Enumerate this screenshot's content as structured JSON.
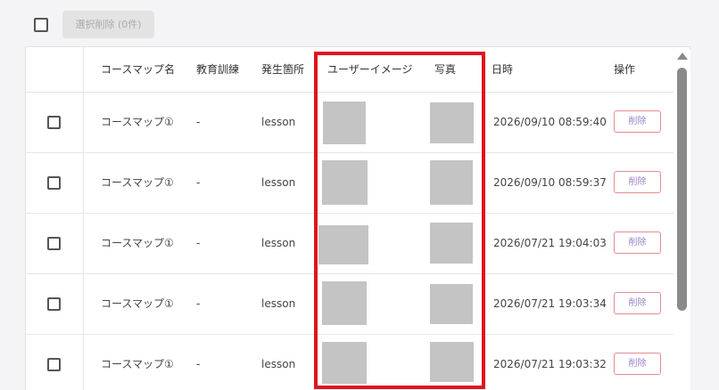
{
  "toolbar": {
    "bulk_delete_label": "選択削除 (0件)"
  },
  "table": {
    "headers": {
      "course_map_name": "コースマップ名",
      "training": "教育訓練",
      "location": "発生箇所",
      "user_image": "ユーザーイメージ",
      "photo": "写真",
      "datetime": "日時",
      "actions": "操作"
    },
    "rows": [
      {
        "course_map_name": "コースマップ①",
        "training": "-",
        "location": "lesson",
        "datetime": "2026/09/10 08:59:40",
        "delete_label": "削除"
      },
      {
        "course_map_name": "コースマップ①",
        "training": "-",
        "location": "lesson",
        "datetime": "2026/09/10 08:59:37",
        "delete_label": "削除"
      },
      {
        "course_map_name": "コースマップ①",
        "training": "-",
        "location": "lesson",
        "datetime": "2026/07/21 19:04:03",
        "delete_label": "削除"
      },
      {
        "course_map_name": "コースマップ①",
        "training": "-",
        "location": "lesson",
        "datetime": "2026/07/21 19:03:34",
        "delete_label": "削除"
      },
      {
        "course_map_name": "コースマップ①",
        "training": "-",
        "location": "lesson",
        "datetime": "2026/07/21 19:03:32",
        "delete_label": "削除"
      }
    ]
  },
  "colors": {
    "highlight": "#e0131d",
    "delete_border": "#e58a92",
    "delete_text": "#9a7fc6",
    "placeholder_image": "#c4c4c4"
  }
}
